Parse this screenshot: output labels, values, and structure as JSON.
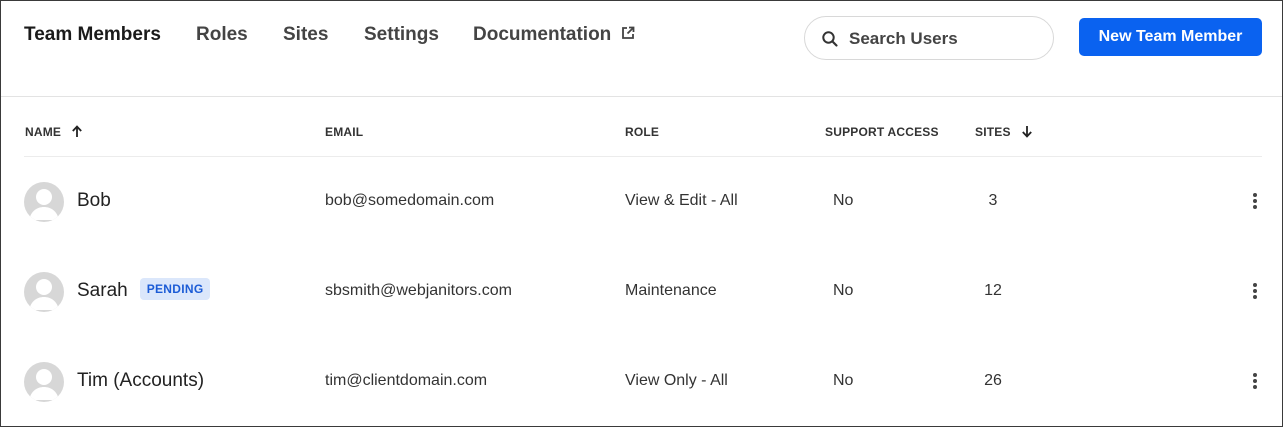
{
  "nav": {
    "tabs": [
      {
        "label": "Team Members"
      },
      {
        "label": "Roles"
      },
      {
        "label": "Sites"
      },
      {
        "label": "Settings"
      },
      {
        "label": "Documentation"
      }
    ],
    "active_tab": "Team Members"
  },
  "search": {
    "placeholder": "Search Users",
    "value": ""
  },
  "actions": {
    "new_member_label": "New Team Member"
  },
  "table": {
    "headers": {
      "name": "NAME",
      "email": "EMAIL",
      "role": "ROLE",
      "support": "SUPPORT ACCESS",
      "sites": "SITES"
    },
    "rows": [
      {
        "name": "Bob",
        "badge": "",
        "email": "bob@somedomain.com",
        "role": "View & Edit - All",
        "support": "No",
        "sites": "3"
      },
      {
        "name": "Sarah",
        "badge": "PENDING",
        "email": "sbsmith@webjanitors.com",
        "role": "Maintenance",
        "support": "No",
        "sites": "12"
      },
      {
        "name": "Tim (Accounts)",
        "badge": "",
        "email": "tim@clientdomain.com",
        "role": "View Only - All",
        "support": "No",
        "sites": "26"
      }
    ]
  },
  "icons": {
    "external": "external-link-icon",
    "search": "search-icon",
    "sort_name": "arrow-up-icon",
    "sort_sites": "arrow-down-icon",
    "avatar": "user-avatar-icon",
    "row_menu": "more-vertical-icon"
  },
  "colors": {
    "accent": "#0a62f0",
    "badge_bg": "#dbe7fb",
    "badge_text": "#1c5cd6",
    "avatar": "#d7d7d7"
  }
}
